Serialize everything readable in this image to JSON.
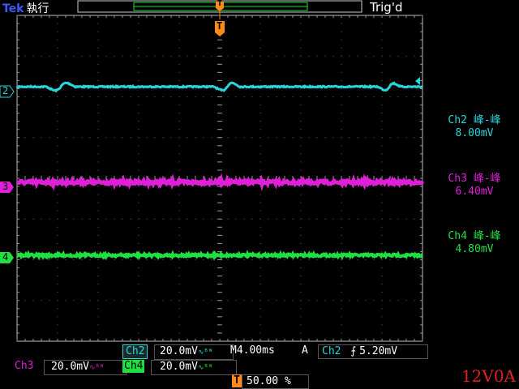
{
  "header": {
    "brand": "Tek",
    "run_state": "執行",
    "trigger_status": "Trig'd"
  },
  "colors": {
    "ch2": "#27d6dc",
    "ch3": "#e020d8",
    "ch4": "#20e040",
    "grid": "#7a7a7a",
    "trigger_marker": "#ff8a1a",
    "frame": "#ffffff"
  },
  "channels": [
    {
      "id": "2",
      "label": "Ch2",
      "color": "#27d6dc",
      "scale": "20.0mV",
      "meas_title": "Ch2 峰-峰",
      "meas_value": "8.00mV"
    },
    {
      "id": "3",
      "label": "Ch3",
      "color": "#e020d8",
      "scale": "20.0mV",
      "meas_title": "Ch3 峰-峰",
      "meas_value": "6.40mV"
    },
    {
      "id": "4",
      "label": "Ch4",
      "color": "#20e040",
      "scale": "20.0mV",
      "meas_title": "Ch4 峰-峰",
      "meas_value": "4.80mV"
    }
  ],
  "bandwidth_icon": "bw-limit-icon",
  "timebase": {
    "label": "M",
    "value": "4.00ms"
  },
  "trigger": {
    "mode": "A",
    "source": "Ch2",
    "slope_icon": "rising-edge-icon",
    "level": "5.20mV",
    "position_marker": "T",
    "position": "50.00 %"
  },
  "overlay_label": "12V0A"
}
